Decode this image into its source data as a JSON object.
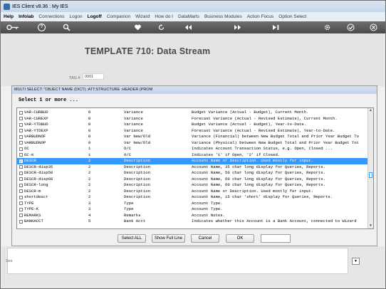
{
  "window": {
    "title": "IES Client v8.36 : My IES"
  },
  "menu": [
    "Help",
    "Infolab",
    "Connections",
    "Logon",
    "Logoff",
    "Companion",
    "Wizard",
    "How do I",
    "DataMarts",
    "Business Modules",
    "Action Focus",
    "Option Select"
  ],
  "toolbar": {
    "icons": [
      "key-icon",
      "help-icon",
      "search-icon",
      "heart-icon",
      "refresh-icon",
      "rewind-icon",
      "fast-forward-icon",
      "last-icon",
      "settings-icon",
      "check-icon",
      "close-icon"
    ],
    "help_glyph": "?"
  },
  "page": {
    "heading": "TEMPLATE 710: Data Stream",
    "tag_label": "TAG #",
    "tag_value": "0001"
  },
  "dialog": {
    "title": "MULTI SELECT: \"OBJECT NAME (DICT) :ATT:STRUCTURE :HEADER (PROM",
    "prompt": "Select 1 or more ...",
    "rows": [
      {
        "name": "VAR-CURBUD",
        "len": "0",
        "type": "Variance",
        "desc": "Budget Variance (Actual - Budget), Current Month.",
        "checked": false,
        "selected": false
      },
      {
        "name": "VAR-CUREXP",
        "len": "0",
        "type": "Variance",
        "desc": "Forecast Variance (Actual - Revised Estimate), Current Month.",
        "checked": false,
        "selected": false
      },
      {
        "name": "VAR-YTDBUD",
        "len": "0",
        "type": "Variance",
        "desc": "Budget Variance (Actual - Budget), Year-to-Date.",
        "checked": false,
        "selected": false
      },
      {
        "name": "VAR-YTDEXP",
        "len": "0",
        "type": "Variance",
        "desc": "Forecast Variance (Actual - Revised Estimate), Year-to-Date.",
        "checked": false,
        "selected": false
      },
      {
        "name": "VARBUDNOF",
        "len": "0",
        "type": "Var New/Old",
        "desc": "Variance (Financial) between New Budget Total and Prior Year Budget To",
        "checked": false,
        "selected": false
      },
      {
        "name": "VARBUDNOP",
        "len": "0",
        "type": "Var New/Old",
        "desc": "Variance (Physical) between New Budget Total and Prior Year Budget Tot",
        "checked": false,
        "selected": false
      },
      {
        "name": "OC",
        "len": "1",
        "type": "O/C",
        "desc": "Indicates Account Transaction Status, e.g. Open, Closed ...",
        "checked": false,
        "selected": false
      },
      {
        "name": "OC-K",
        "len": "1",
        "type": "O/C",
        "desc": "Indicates '1' if Open, '2' if Closed.",
        "checked": false,
        "selected": false
      },
      {
        "name": "DESCR",
        "len": "2",
        "type": "Description",
        "desc": "Account Name or Description. Used mostly for input.",
        "checked": true,
        "selected": true
      },
      {
        "name": "DESCR-disp35",
        "len": "2",
        "type": "Description",
        "desc": "Account Name, 35 char long display for Queries, Reports.",
        "checked": false,
        "selected": false
      },
      {
        "name": "DESCR-disp50",
        "len": "2",
        "type": "Description",
        "desc": "Account Name, 50 char long display for Queries, Reports.",
        "checked": false,
        "selected": false
      },
      {
        "name": "DESCR-disp60",
        "len": "2",
        "type": "Description",
        "desc": "Account Name, 60 char long display for Queries, Reports.",
        "checked": false,
        "selected": false
      },
      {
        "name": "DESCR-long",
        "len": "2",
        "type": "Description",
        "desc": "Account Name, 60 char long display for Queries, Reports.",
        "checked": false,
        "selected": false
      },
      {
        "name": "DESCR-m",
        "len": "2",
        "type": "Description",
        "desc": "Account Name or Description. Used mostly for input.",
        "checked": false,
        "selected": false
      },
      {
        "name": "shortdescr",
        "len": "2",
        "type": "Description",
        "desc": "Account Name, 15 char 'short' display for Queries, Reports.",
        "checked": false,
        "selected": false
      },
      {
        "name": "TYPE",
        "len": "3",
        "type": "Type",
        "desc": "Account Type.",
        "checked": false,
        "selected": false
      },
      {
        "name": "TYPE-K",
        "len": "3",
        "type": "Type",
        "desc": "Account Type.",
        "checked": false,
        "selected": false
      },
      {
        "name": "REMARKS",
        "len": "4",
        "type": "Remarks",
        "desc": "Account Notes.",
        "checked": false,
        "selected": false
      },
      {
        "name": "BANKACCT",
        "len": "5",
        "type": "Bank Acct",
        "desc": "Indicates whether this Account is a Bank Account, connected to Wizard",
        "checked": false,
        "selected": false
      }
    ],
    "buttons": {
      "select_all": "Select ALL",
      "show_full_line": "Show Full Line",
      "cancel": "Cancel",
      "ok": "OK"
    },
    "check_mark": "✓"
  },
  "footer": {
    "side_label": "Ses"
  },
  "colors": {
    "selection": "#3399ff",
    "toolbar": "#5a5a5a",
    "heading": "#4a4a4a"
  }
}
